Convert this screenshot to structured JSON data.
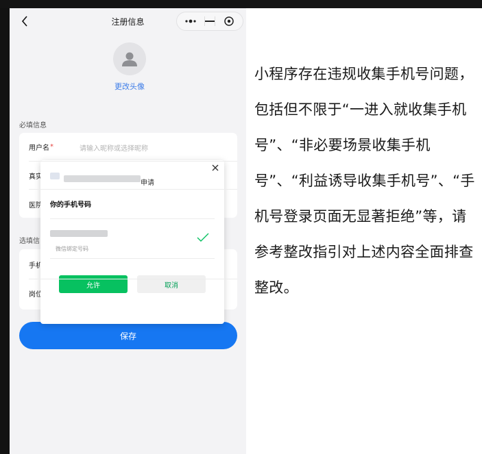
{
  "nav": {
    "title": "注册信息"
  },
  "avatar": {
    "change_label": "更改头像"
  },
  "required_section": {
    "label": "必填信息"
  },
  "optional_section": {
    "label": "选填信"
  },
  "fields": {
    "username_label": "用户名",
    "username_required_mark": "*",
    "username_placeholder": "请输入昵称或选择昵称",
    "real_name_partial": "真实",
    "hospital_partial": "医院",
    "phone_partial": "手机",
    "position_partial": "岗位"
  },
  "save_label": "保存",
  "dialog": {
    "request_suffix": "申请",
    "title": "你的手机号码",
    "phone_hint": "微信绑定号码",
    "allow_label": "允许",
    "cancel_label": "取消"
  },
  "note": {
    "text": "小程序存在违规收集手机号问题，包括但不限于“一进入就收集手机号”、“非必要场景收集手机号”、“利益诱导收集手机号”、“手机号登录页面无显著拒绝”等，请参考整改指引对上述内容全面排查整改。"
  },
  "colors": {
    "primary_blue": "#1677f2",
    "wechat_green": "#07c160",
    "required_red": "#e64340",
    "link_blue": "#3e7de8"
  }
}
